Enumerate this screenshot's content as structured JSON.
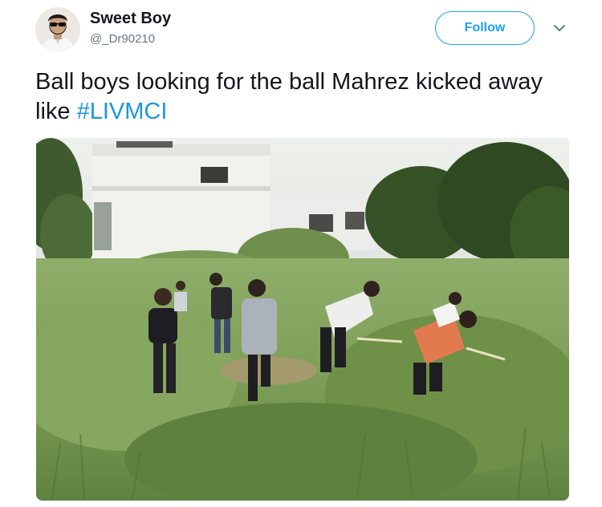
{
  "author": {
    "display_name": "Sweet Boy",
    "username": "@_Dr90210"
  },
  "follow_button": {
    "label": "Follow"
  },
  "tweet": {
    "text": "Ball boys looking for the ball Mahrez kicked away like ",
    "hashtag": "#LIVMCI"
  },
  "icons": {
    "menu": "chevron-down-icon"
  },
  "colors": {
    "accent": "#1da1f2",
    "hashtag": "#1b95e0",
    "text": "#14171a",
    "secondary_text": "#657786"
  }
}
